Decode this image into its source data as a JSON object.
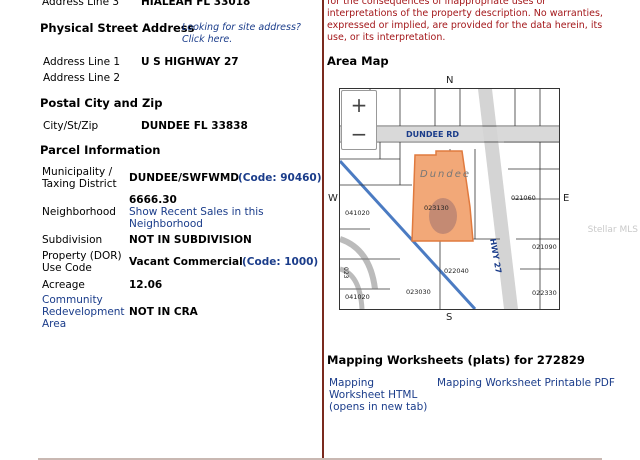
{
  "owner": {
    "address_line3_label": "Address Line 3",
    "address_line3_value": "HIALEAH FL 33018"
  },
  "physical": {
    "title": "Physical Street Address",
    "hint": "Looking for site address? Click here.",
    "line1_label": "Address Line 1",
    "line1_value": "U S HIGHWAY 27",
    "line2_label": "Address Line 2"
  },
  "postal": {
    "title": "Postal City and Zip",
    "label": "City/St/Zip",
    "value": "DUNDEE FL 33838"
  },
  "parcel": {
    "title": "Parcel Information",
    "municipality_label": "Municipality / Taxing District",
    "municipality_value": "DUNDEE/SWFWMD",
    "municipality_code": "(Code: 90460)",
    "neighborhood_number": "6666.30",
    "neighborhood_label": "Neighborhood",
    "neighborhood_link": "Show Recent Sales in this Neighborhood",
    "subdivision_label": "Subdivision",
    "subdivision_value": "NOT IN SUBDIVISION",
    "use_label": "Property (DOR) Use Code",
    "use_value": "Vacant Commercial",
    "use_code": "(Code: 1000)",
    "acreage_label": "Acreage",
    "acreage_value": "12.06",
    "cra_label": "Community Redevelopment Area",
    "cra_value": "NOT IN CRA"
  },
  "disclaimer": "for the consequences of inappropriate uses or interpretations of the property description. No warranties, expressed or implied, are provided for the data herein, its use, or its interpretation.",
  "map": {
    "title": "Area Map",
    "north": "N",
    "south": "S",
    "east": "E",
    "west": "W",
    "road_label": "DUNDEE RD",
    "town_label": "Dundee",
    "hwy_label": "HWY 27",
    "zoom_in": "+",
    "zoom_out": "−",
    "parcels": [
      "023130",
      "021060",
      "041020",
      "021090",
      "022040",
      "023030",
      "022330",
      "041020"
    ],
    "side_code": "023",
    "highlight_color": "#f2a878"
  },
  "worksheets": {
    "title": "Mapping Worksheets (plats) for 272829",
    "link1": "Mapping Worksheet HTML (opens in new tab)",
    "link2": "Mapping Worksheet Printable PDF"
  },
  "watermark": "Stellar MLS"
}
